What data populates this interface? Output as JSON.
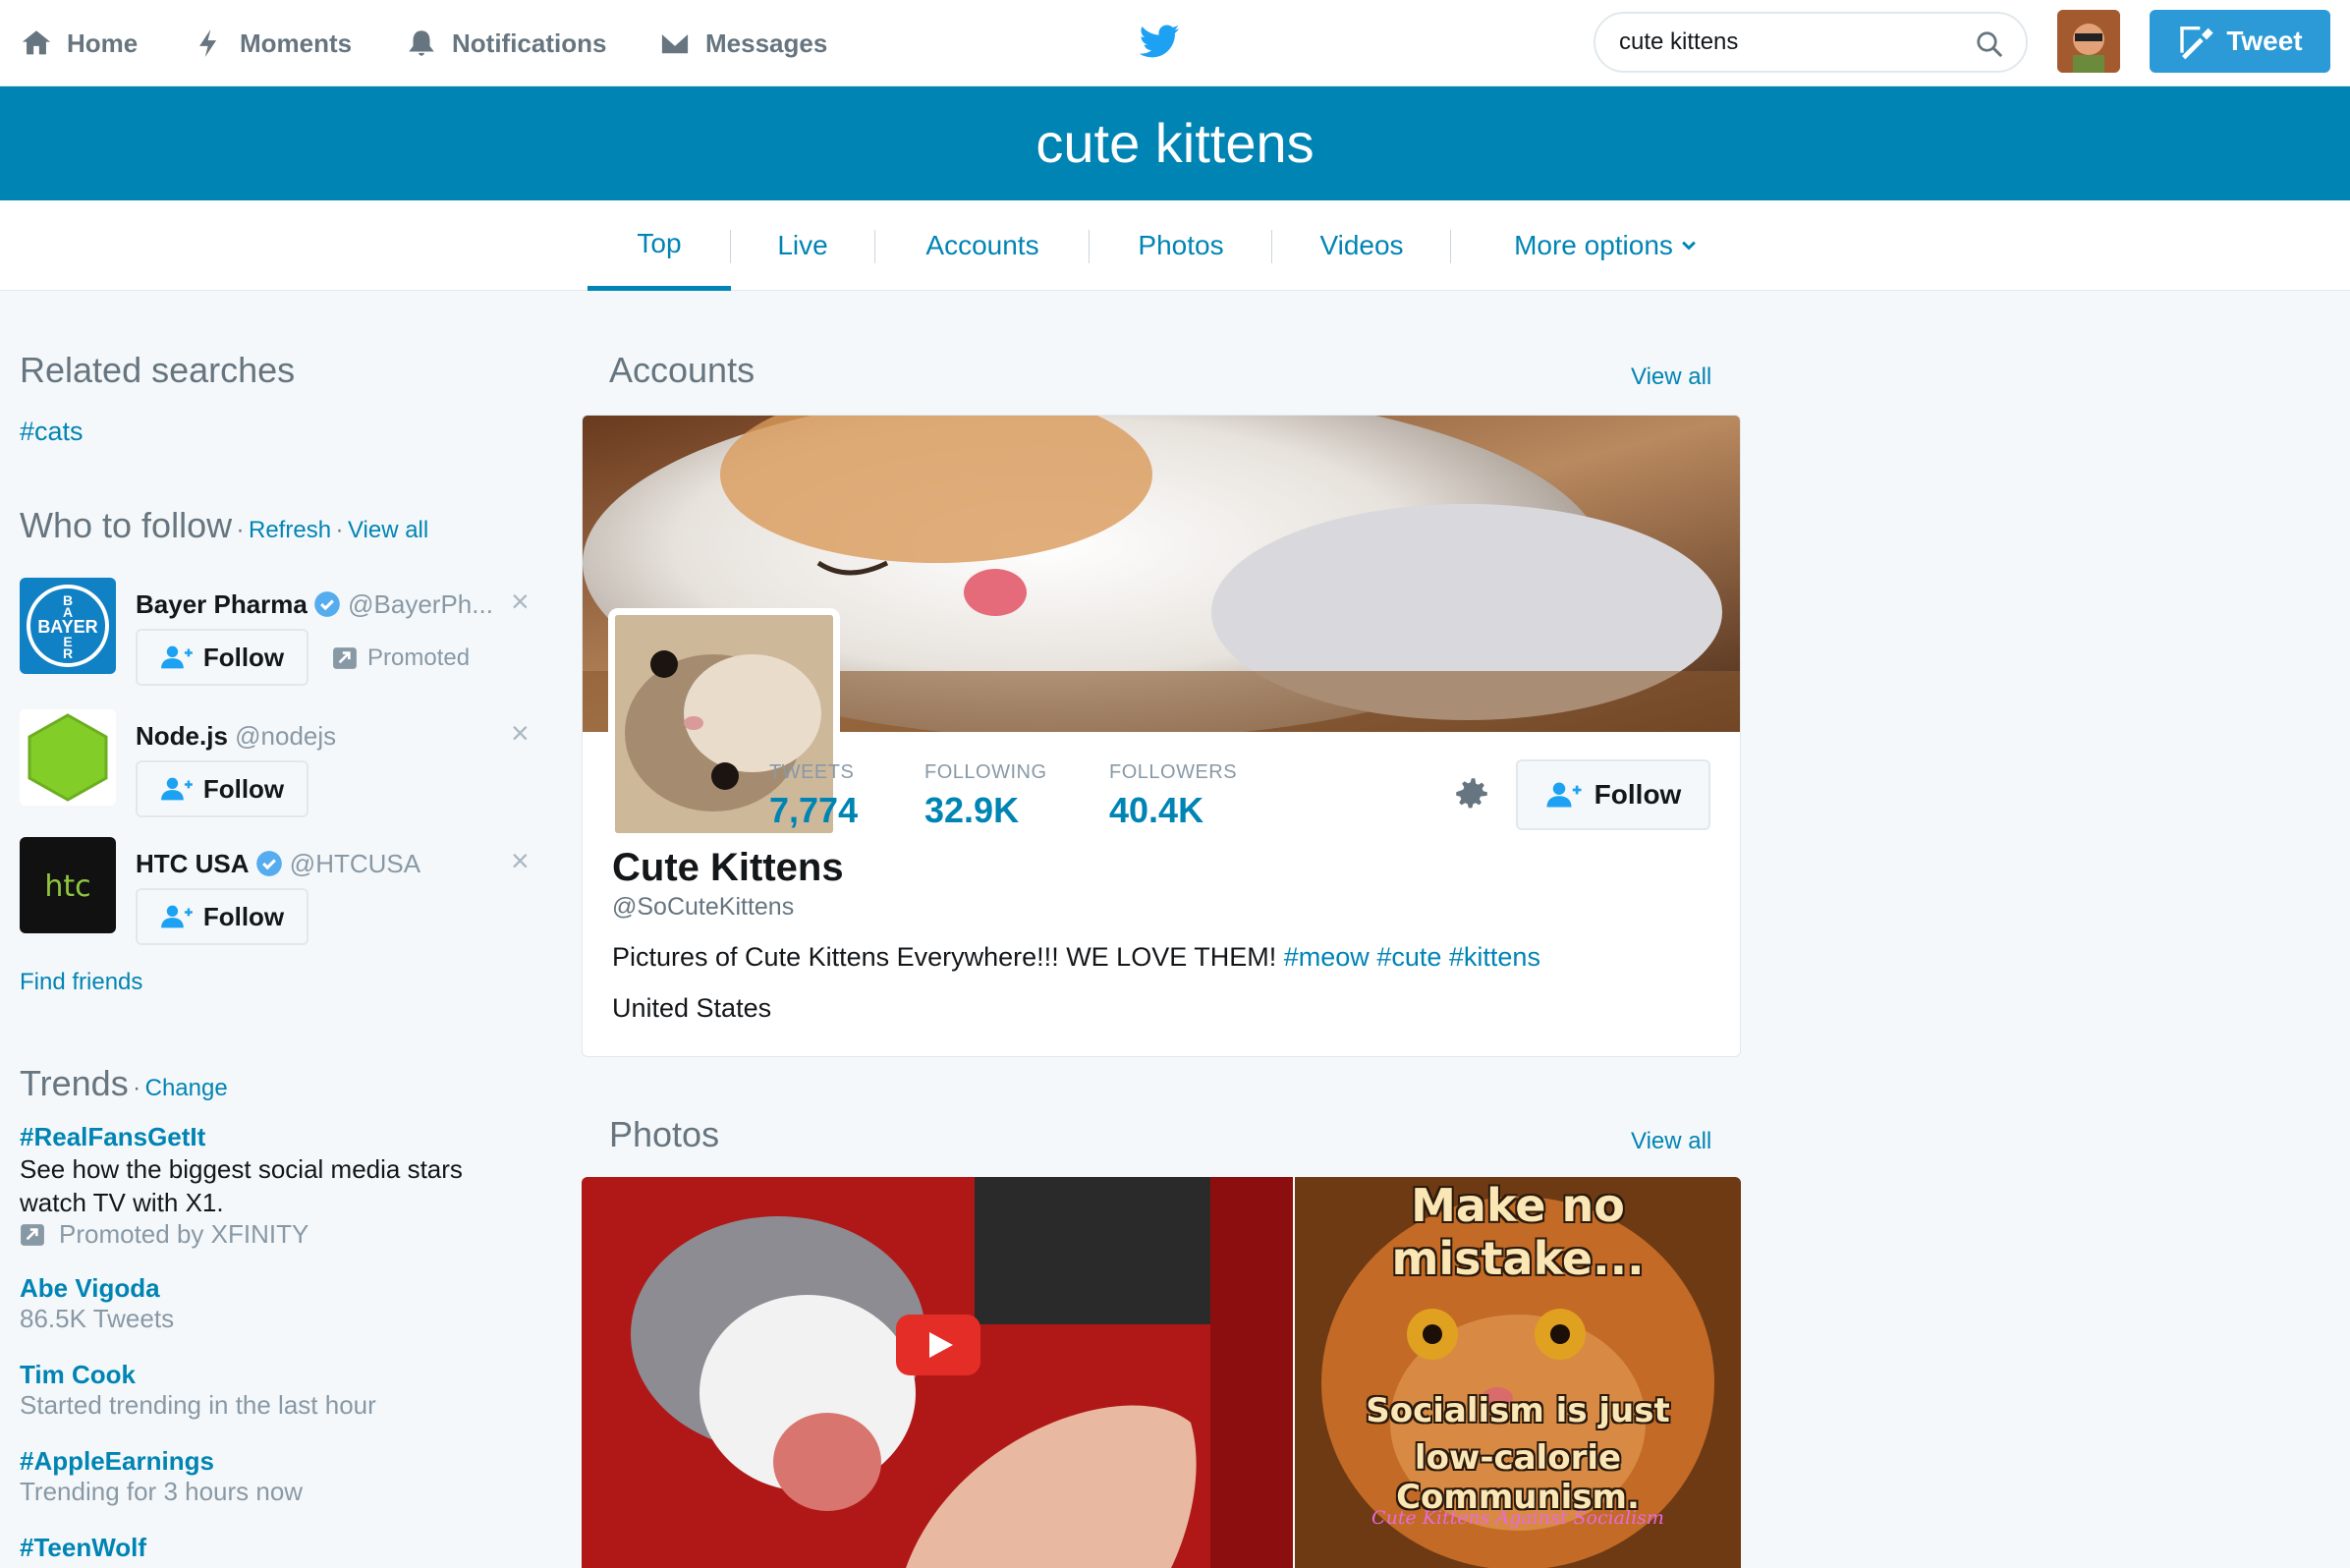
{
  "nav": {
    "home": "Home",
    "moments": "Moments",
    "notifications": "Notifications",
    "messages": "Messages",
    "tweet_label": "Tweet"
  },
  "search": {
    "value": "cute kittens"
  },
  "banner": {
    "title": "cute kittens"
  },
  "tabs": [
    {
      "label": "Top"
    },
    {
      "label": "Live"
    },
    {
      "label": "Accounts"
    },
    {
      "label": "Photos"
    },
    {
      "label": "Videos"
    },
    {
      "label": "More options"
    }
  ],
  "related": {
    "title": "Related searches",
    "items": [
      "#cats"
    ]
  },
  "who_to_follow": {
    "title": "Who to follow",
    "refresh": "Refresh",
    "view_all": "View all",
    "separator": "·",
    "follow_label": "Follow",
    "promoted_label": "Promoted",
    "accounts": [
      {
        "name": "Bayer Pharma",
        "handle": "@BayerPh...",
        "logo_text": "BAYER"
      },
      {
        "name": "Node.js",
        "handle": "@nodejs"
      },
      {
        "name": "HTC USA",
        "handle": "@HTCUSA",
        "logo_text": "htc"
      }
    ],
    "find_friends": "Find friends"
  },
  "trends": {
    "title": "Trends",
    "change": "Change",
    "items": [
      {
        "name": "#RealFansGetIt",
        "desc": "See how the biggest social media stars watch TV with X1.",
        "meta": "Promoted by XFINITY"
      },
      {
        "name": "Abe Vigoda",
        "meta": "86.5K Tweets"
      },
      {
        "name": "Tim Cook",
        "meta": "Started trending in the last hour"
      },
      {
        "name": "#AppleEarnings",
        "meta": "Trending for 3 hours now"
      },
      {
        "name": "#TeenWolf"
      }
    ]
  },
  "accounts_section": {
    "title": "Accounts",
    "view_all": "View all",
    "profile": {
      "name": "Cute Kittens",
      "handle": "@SoCuteKittens",
      "bio_text": "Pictures of Cute Kittens Everywhere!!! WE LOVE THEM!",
      "bio_hashtags": [
        "#meow",
        "#cute",
        "#kittens"
      ],
      "location": "United States",
      "stats": [
        {
          "label": "TWEETS",
          "value": "7,774"
        },
        {
          "label": "FOLLOWING",
          "value": "32.9K"
        },
        {
          "label": "FOLLOWERS",
          "value": "40.4K"
        }
      ],
      "follow_label": "Follow"
    }
  },
  "photos_section": {
    "title": "Photos",
    "view_all": "View all",
    "meme": {
      "top": "Make no mistake...",
      "line1": "Socialism is just",
      "line2": "low-calorie Communism.",
      "footer": "Cute Kittens Against Socialism"
    }
  },
  "colors": {
    "accent": "#0084b4",
    "tweet_button": "#2b9ad6",
    "muted": "#66757f",
    "background": "#f5f8fa"
  }
}
